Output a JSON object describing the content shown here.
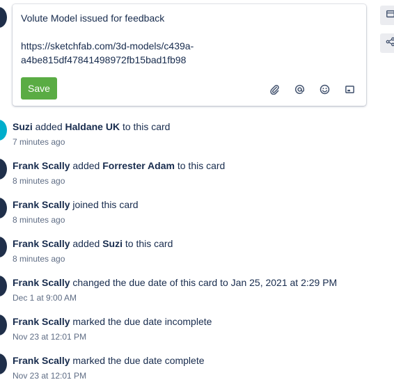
{
  "comment": {
    "lines": [
      "Volute Model issued for feedback",
      "",
      "https://sketchfab.com/3d-models/c439a-",
      "a4be815df47841498972fb15bad1fb98"
    ],
    "save_label": "Save",
    "tools": [
      "attachment-icon",
      "mention-icon",
      "emoji-icon",
      "card-icon"
    ]
  },
  "side_actions": [
    "card-icon",
    "share-icon"
  ],
  "activity": [
    {
      "actor": "Suzi",
      "pre": " added ",
      "target": "Haldane UK",
      "post": " to this card",
      "time": "7 minutes ago",
      "avatar_color": "#00aecc"
    },
    {
      "actor": "Frank Scally",
      "pre": " added ",
      "target": "Forrester Adam",
      "post": " to this card",
      "time": "8 minutes ago",
      "avatar_color": "#1f2f4a"
    },
    {
      "actor": "Frank Scally",
      "pre": " joined this card",
      "target": "",
      "post": "",
      "time": "8 minutes ago",
      "avatar_color": "#1f2f4a"
    },
    {
      "actor": "Frank Scally",
      "pre": " added ",
      "target": "Suzi",
      "post": " to this card",
      "time": "8 minutes ago",
      "avatar_color": "#1f2f4a"
    },
    {
      "actor": "Frank Scally",
      "pre": " changed the due date of this card to Jan 25, 2021 at 2:29 PM",
      "target": "",
      "post": "",
      "time": "Dec 1 at 9:00 AM",
      "avatar_color": "#1f2f4a"
    },
    {
      "actor": "Frank Scally",
      "pre": " marked the due date incomplete",
      "target": "",
      "post": "",
      "time": "Nov 23 at 12:01 PM",
      "avatar_color": "#1f2f4a"
    },
    {
      "actor": "Frank Scally",
      "pre": " marked the due date complete",
      "target": "",
      "post": "",
      "time": "Nov 23 at 12:01 PM",
      "avatar_color": "#1f2f4a"
    }
  ]
}
